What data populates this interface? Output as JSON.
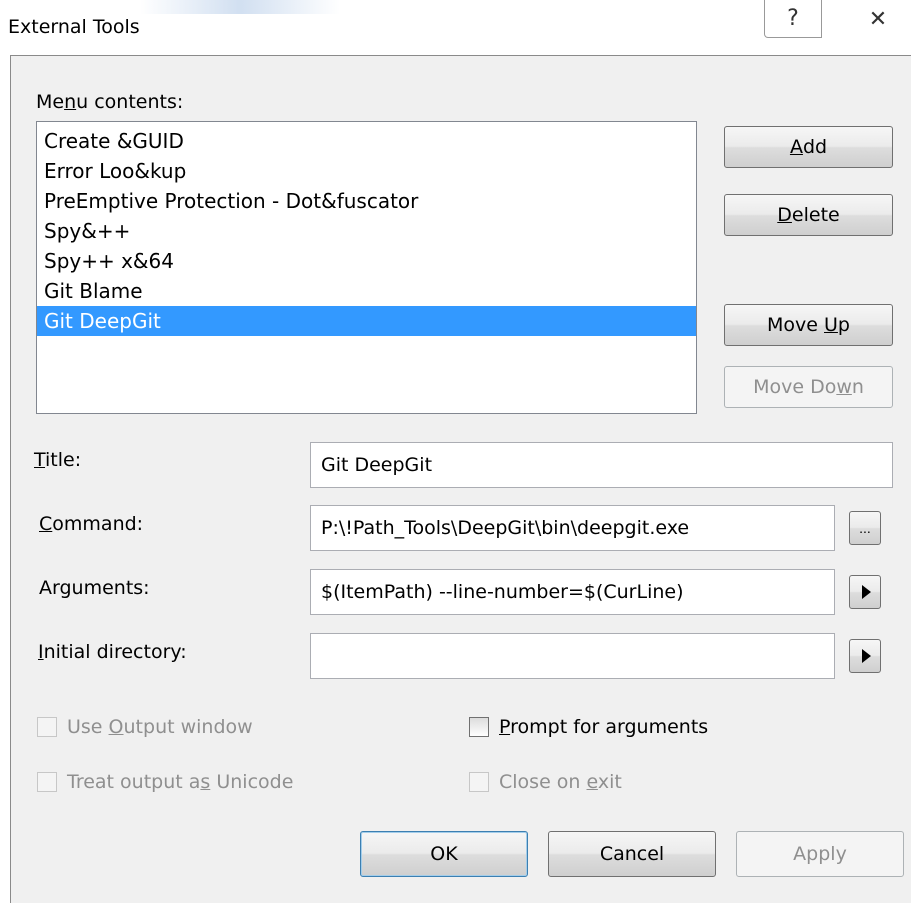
{
  "window": {
    "title": "External Tools",
    "help_icon": "?",
    "close_icon": "✕"
  },
  "menu_contents": {
    "label_pre": "Me",
    "label_key": "n",
    "label_post": "u contents:",
    "items": [
      {
        "label": "Create &GUID",
        "selected": false
      },
      {
        "label": "Error Loo&kup",
        "selected": false
      },
      {
        "label": "PreEmptive Protection - Dot&fuscator",
        "selected": false
      },
      {
        "label": "Spy&++",
        "selected": false
      },
      {
        "label": "Spy++ x&64",
        "selected": false
      },
      {
        "label": "Git Blame",
        "selected": false
      },
      {
        "label": "Git DeepGit",
        "selected": true
      }
    ]
  },
  "side_buttons": {
    "add": {
      "key": "A",
      "rest": "dd"
    },
    "delete": {
      "key": "D",
      "rest": "elete"
    },
    "move_up": {
      "pre": "Move ",
      "key": "U",
      "rest": "p"
    },
    "move_down": {
      "pre": "Move Do",
      "key": "w",
      "rest": "n"
    }
  },
  "fields": {
    "title": {
      "label_key": "T",
      "label_rest": "itle:",
      "value": "Git DeepGit"
    },
    "command": {
      "label_key": "C",
      "label_rest": "ommand:",
      "value": "P:\\!Path_Tools\\DeepGit\\bin\\deepgit.exe",
      "browse_label": "..."
    },
    "arguments": {
      "label": "Arguments:",
      "value": "$(ItemPath) --line-number=$(CurLine)"
    },
    "initial_directory": {
      "label_key": "I",
      "label_rest": "nitial directory:",
      "value": ""
    }
  },
  "options": {
    "use_output": {
      "pre": "Use ",
      "key": "O",
      "rest": "utput window",
      "checked": false,
      "enabled": false
    },
    "prompt_args": {
      "key": "P",
      "rest": "rompt for arguments",
      "checked": false,
      "enabled": true
    },
    "unicode": {
      "pre": "Treat output a",
      "key": "s",
      "rest": " Unicode",
      "checked": false,
      "enabled": false
    },
    "close_exit": {
      "pre": "Close on ",
      "key": "e",
      "rest": "xit",
      "checked": false,
      "enabled": false
    }
  },
  "footer": {
    "ok": "OK",
    "cancel": "Cancel",
    "apply": "Apply"
  }
}
